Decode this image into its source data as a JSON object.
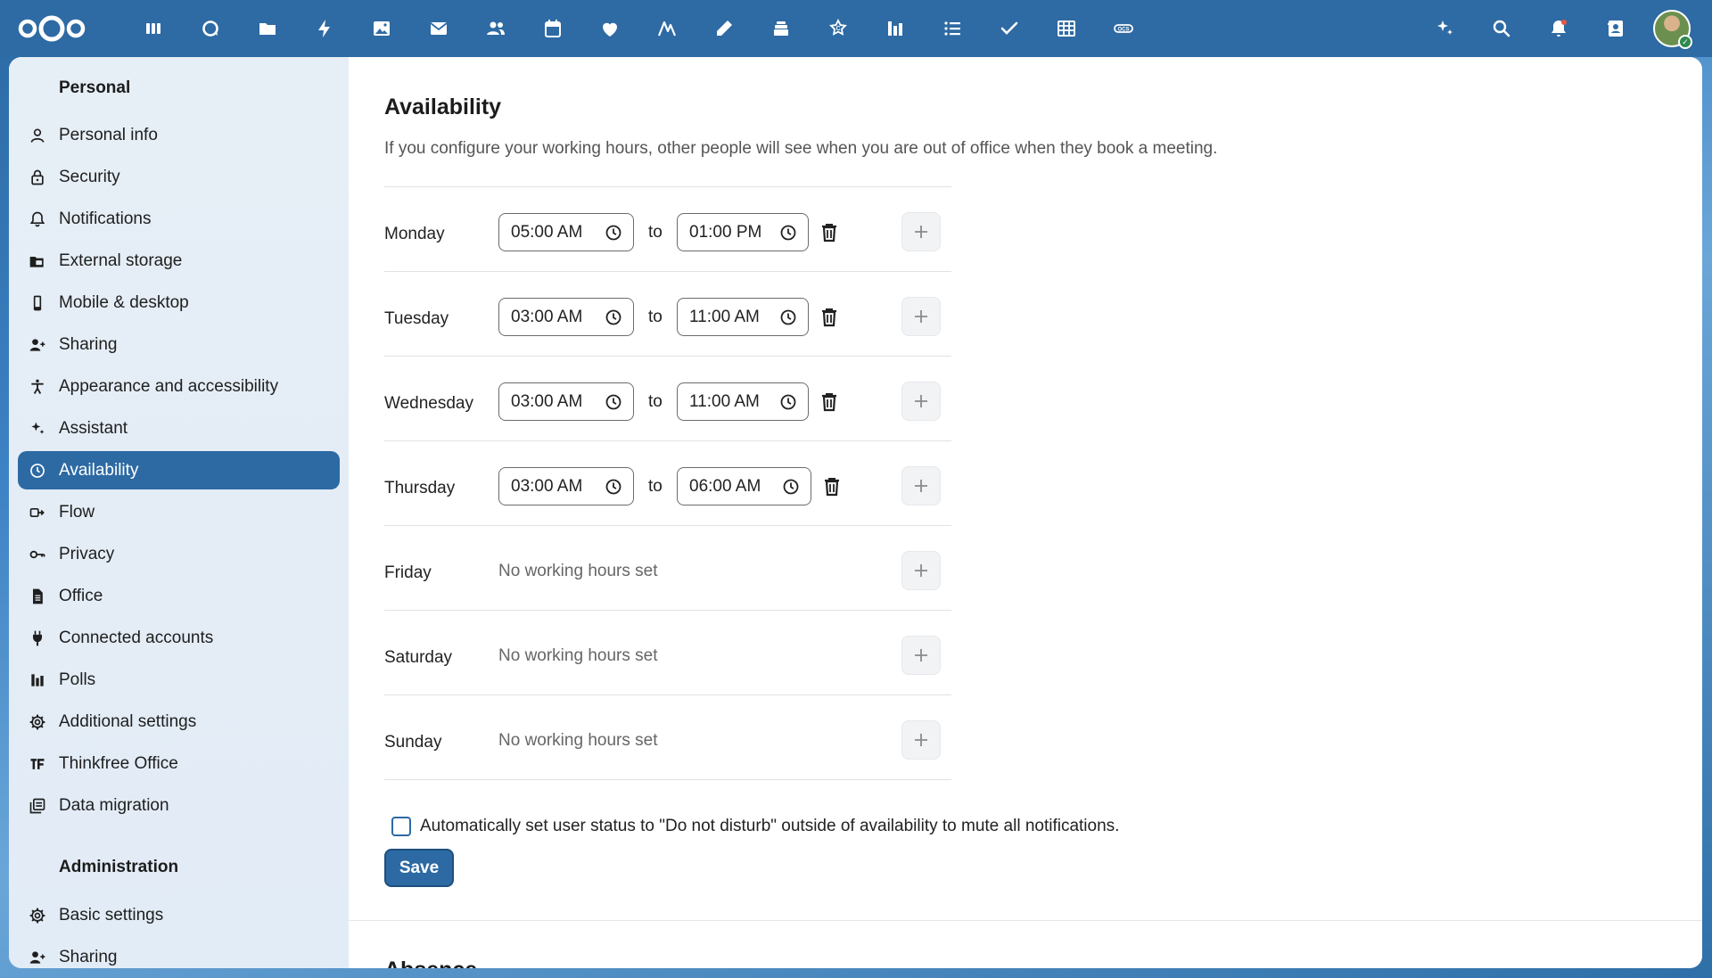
{
  "topbar": {
    "apps": [
      "dashboard-icon",
      "talk-icon",
      "files-icon",
      "activity-icon",
      "photos-icon",
      "mail-icon",
      "contacts-icon",
      "calendar-icon",
      "health-icon",
      "analytics-icon",
      "notes-icon",
      "deck-icon",
      "cospend-icon",
      "polls-icon",
      "tasks-list-icon",
      "tasks-check-icon",
      "tables-icon",
      "ocs-icon"
    ],
    "right": [
      "assistant-icon",
      "search-icon",
      "notifications-icon",
      "contacts-menu-icon"
    ]
  },
  "sidebar": {
    "personal_title": "Personal",
    "admin_title": "Administration",
    "personal_items": [
      {
        "label": "Personal info",
        "icon": "person-icon"
      },
      {
        "label": "Security",
        "icon": "lock-icon"
      },
      {
        "label": "Notifications",
        "icon": "bell-icon"
      },
      {
        "label": "External storage",
        "icon": "folder-storage-icon"
      },
      {
        "label": "Mobile & desktop",
        "icon": "phone-icon"
      },
      {
        "label": "Sharing",
        "icon": "share-person-icon"
      },
      {
        "label": "Appearance and accessibility",
        "icon": "accessibility-icon"
      },
      {
        "label": "Assistant",
        "icon": "sparkle-icon"
      },
      {
        "label": "Availability",
        "icon": "clock-icon"
      },
      {
        "label": "Flow",
        "icon": "flow-icon"
      },
      {
        "label": "Privacy",
        "icon": "key-icon"
      },
      {
        "label": "Office",
        "icon": "document-icon"
      },
      {
        "label": "Connected accounts",
        "icon": "plug-icon"
      },
      {
        "label": "Polls",
        "icon": "poll-icon"
      },
      {
        "label": "Additional settings",
        "icon": "gear-icon"
      },
      {
        "label": "Thinkfree Office",
        "icon": "thinkfree-icon"
      },
      {
        "label": "Data migration",
        "icon": "migration-icon"
      }
    ],
    "admin_items": [
      {
        "label": "Basic settings",
        "icon": "gear-icon"
      },
      {
        "label": "Sharing",
        "icon": "share-person-icon"
      }
    ],
    "active": "Availability"
  },
  "main": {
    "title": "Availability",
    "description": "If you configure your working hours, other people will see when you are out of office when they book a meeting.",
    "to_label": "to",
    "no_hours_label": "No working hours set",
    "days": [
      {
        "name": "Monday",
        "start": "05:00 AM",
        "end": "01:00 PM"
      },
      {
        "name": "Tuesday",
        "start": "03:00 AM",
        "end": "11:00 AM"
      },
      {
        "name": "Wednesday",
        "start": "03:00 AM",
        "end": "11:00 AM"
      },
      {
        "name": "Thursday",
        "start": "03:00 AM",
        "end": "06:00 AM"
      },
      {
        "name": "Friday"
      },
      {
        "name": "Saturday"
      },
      {
        "name": "Sunday"
      }
    ],
    "dnd_label": "Automatically set user status to \"Do not disturb\" outside of availability to mute all notifications.",
    "dnd_checked": false,
    "save_label": "Save",
    "next_section_title": "Absence"
  },
  "colors": {
    "primary": "#2d6aa3",
    "header": "#2e6aa3"
  }
}
